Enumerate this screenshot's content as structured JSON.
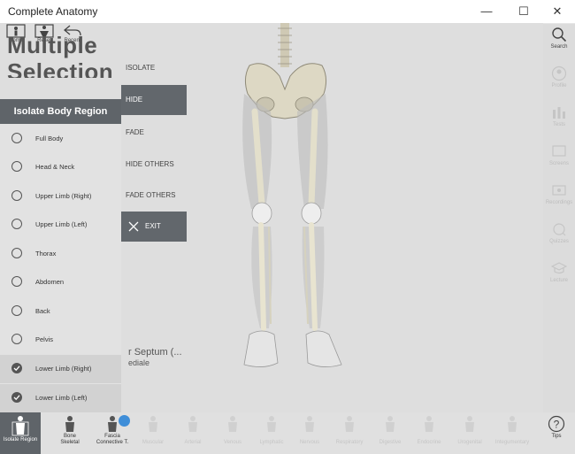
{
  "window": {
    "title": "Complete Anatomy",
    "minimize": "—",
    "maximize": "☐",
    "close": "✕"
  },
  "toolbar": [
    {
      "label": "Home",
      "icon": "home-icon"
    },
    {
      "label": "Reset",
      "icon": "reset-icon"
    },
    {
      "label": "Recent",
      "icon": "recent-icon"
    }
  ],
  "page_title_line1": "Multiple",
  "page_title_line2": "Selection",
  "region_panel": {
    "title": "Isolate Body Region",
    "items": [
      {
        "label": "Full Body",
        "checked": false
      },
      {
        "label": "Head & Neck",
        "checked": false
      },
      {
        "label": "Upper Limb (Right)",
        "checked": false
      },
      {
        "label": "Upper Limb (Left)",
        "checked": false
      },
      {
        "label": "Thorax",
        "checked": false
      },
      {
        "label": "Abdomen",
        "checked": false
      },
      {
        "label": "Back",
        "checked": false
      },
      {
        "label": "Pelvis",
        "checked": false
      },
      {
        "label": "Lower Limb (Right)",
        "checked": true
      },
      {
        "label": "Lower Limb (Left)",
        "checked": true
      }
    ]
  },
  "action_menu": [
    {
      "label": "ISOLATE",
      "active": false
    },
    {
      "label": "HIDE",
      "active": true
    },
    {
      "label": "FADE",
      "active": false
    },
    {
      "label": "HIDE OTHERS",
      "active": false
    },
    {
      "label": "FADE OTHERS",
      "active": false
    },
    {
      "label": "EXIT",
      "active": false
    }
  ],
  "selection_text_line1": "r Septum (...",
  "selection_text_line2": "ediale",
  "right_sidebar": [
    {
      "label": "Search",
      "icon": "search-icon"
    },
    {
      "label": "Profile",
      "icon": "profile-icon"
    },
    {
      "label": "Tests",
      "icon": "tests-icon"
    },
    {
      "label": "Screens",
      "icon": "screens-icon"
    },
    {
      "label": "Recordings",
      "icon": "recordings-icon"
    },
    {
      "label": "Quizzes",
      "icon": "quizzes-icon"
    },
    {
      "label": "Lecture",
      "icon": "lecture-icon"
    }
  ],
  "bottom_bar": [
    {
      "label1": "Isolate Region",
      "label2": ""
    },
    {
      "label1": "Bone",
      "label2": "Skeletal"
    },
    {
      "label1": "Fascia",
      "label2": "Connective T."
    },
    {
      "label1": "",
      "label2": "Muscular"
    },
    {
      "label1": "",
      "label2": "Arterial"
    },
    {
      "label1": "",
      "label2": "Venous"
    },
    {
      "label1": "",
      "label2": "Lymphatic"
    },
    {
      "label1": "",
      "label2": "Nervous"
    },
    {
      "label1": "",
      "label2": "Respiratory"
    },
    {
      "label1": "",
      "label2": "Digestive"
    },
    {
      "label1": "",
      "label2": "Endocrine"
    },
    {
      "label1": "",
      "label2": "Urogenital"
    },
    {
      "label1": "",
      "label2": "Integumentary"
    },
    {
      "label1": "Tips",
      "label2": ""
    }
  ]
}
